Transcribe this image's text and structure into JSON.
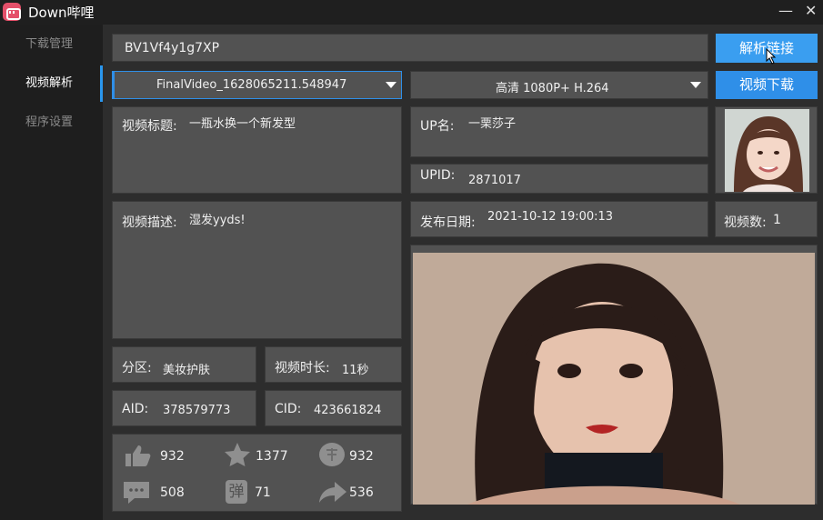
{
  "app": {
    "title": "Down哔哩",
    "minimize": "—",
    "close": "✕"
  },
  "nav": [
    {
      "label": "下载管理",
      "active": false
    },
    {
      "label": "视频解析",
      "active": true
    },
    {
      "label": "程序设置",
      "active": false
    }
  ],
  "url_input": {
    "value": "BV1Vf4y1g7XP"
  },
  "parse_button": "解析链接",
  "download_button": "视频下载",
  "file_select": {
    "value": "FinalVideo_1628065211.548947"
  },
  "quality_select": {
    "value": "高清 1080P+ H.264"
  },
  "info": {
    "title_label": "视频标题:",
    "title_value": "一瓶水换一个新发型",
    "up_label": "UP名:",
    "up_value": "一栗莎子",
    "upid_label": "UPID:",
    "upid_value": "2871017",
    "desc_label": "视频描述:",
    "desc_value": "湿发yyds!",
    "date_label": "发布日期:",
    "date_value": "2021-10-12 19:00:13",
    "count_label": "视频数:",
    "count_value": "1",
    "zone_label": "分区:",
    "zone_value": "美妆护肤",
    "duration_label": "视频时长:",
    "duration_value": "11秒",
    "aid_label": "AID:",
    "aid_value": "378579773",
    "cid_label": "CID:",
    "cid_value": "423661824"
  },
  "stats": {
    "likes": "932",
    "coins": "1377",
    "favorites": "932",
    "comments": "508",
    "danmaku": "71",
    "shares": "536",
    "danmaku_icon_text": "弹"
  },
  "colors": {
    "accent": "#2f8fe8",
    "panel": "#525252",
    "sidebar": "#1e1e1e",
    "logo": "#e4506a"
  }
}
